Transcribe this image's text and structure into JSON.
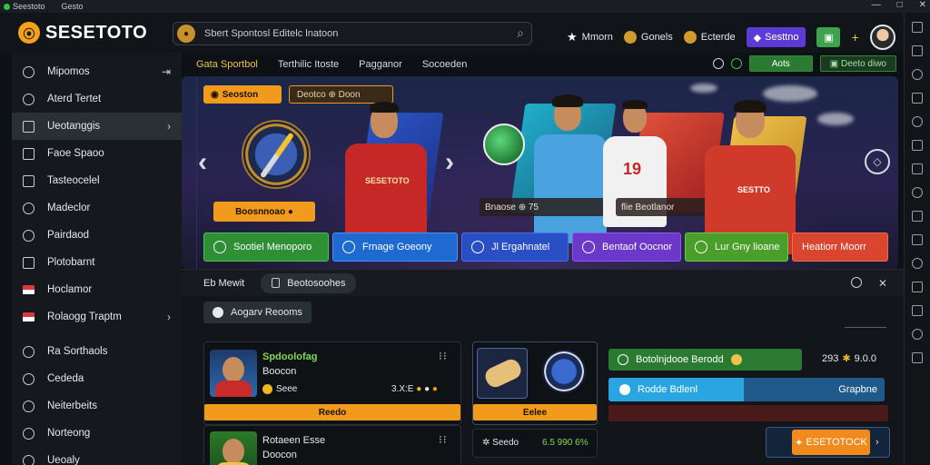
{
  "os_bar": {
    "items": [
      "Seestoto",
      "Gesto"
    ],
    "controls": [
      "—",
      "□",
      "✕"
    ]
  },
  "header": {
    "brand": "SESETOTO",
    "search_text": "Sbert Spontosl Editelc lnatoon",
    "nav": [
      {
        "icon": "star-icon",
        "label": "Mmorn"
      },
      {
        "icon": "coin-icon",
        "label": "Gonels"
      },
      {
        "icon": "coin-icon",
        "label": "Ecterde"
      }
    ],
    "purple_button": "Sesttno",
    "kebab": "⋮"
  },
  "sidebar": {
    "items": [
      {
        "label": "Mipomos",
        "arrow": "⇥",
        "active": false
      },
      {
        "label": "Aterd Tertet",
        "arrow": "",
        "active": false
      },
      {
        "label": "Ueotanggis",
        "arrow": "›",
        "active": true
      },
      {
        "label": "Faoe Spaoo",
        "arrow": "",
        "active": false
      },
      {
        "label": "Tasteocelel",
        "arrow": "",
        "active": false
      },
      {
        "label": "Madeclor",
        "arrow": "",
        "active": false
      },
      {
        "label": "Pairdaod",
        "arrow": "",
        "active": false
      },
      {
        "label": "Plotobarnt",
        "arrow": "",
        "active": false
      },
      {
        "label": "Hoclamor",
        "arrow": "",
        "active": false
      },
      {
        "label": "Rolaogg Traptm",
        "arrow": "›",
        "active": false
      },
      {
        "label": "Ra Sorthaols",
        "arrow": "",
        "active": false
      },
      {
        "label": "Cededa",
        "arrow": "",
        "active": false
      },
      {
        "label": "Neiterbeits",
        "arrow": "",
        "active": false
      },
      {
        "label": "Norteong",
        "arrow": "",
        "active": false
      },
      {
        "label": "Ueoaly",
        "arrow": "",
        "active": false
      }
    ]
  },
  "subnav": {
    "tabs": [
      {
        "label": "Gata Sportbol",
        "active": true
      },
      {
        "label": "Terthilic Itoste",
        "active": false
      },
      {
        "label": "Pagganor",
        "active": false
      },
      {
        "label": "Socoeden",
        "active": false
      }
    ],
    "pill1": "Aots",
    "pill2": "Deeto diwo"
  },
  "hero": {
    "tag_top": "Seoston",
    "tag_dark": "Deotco ⊕ Doon",
    "tag_bottom": "Boosnnoao ●",
    "player_text": "SESETOTO",
    "shirt_number": "19",
    "mid_tag": "Bnaose  ⊕ 75",
    "mid_tag2": "flie   Beotlanor",
    "right_shirt_text": "SESTTO"
  },
  "categories": [
    {
      "label": "Sootiel Menoporo",
      "color": "#2f8f35",
      "border": "#49c455"
    },
    {
      "label": "Frnage Goeony",
      "color": "#1e6ad0",
      "border": "#3f92ff"
    },
    {
      "label": "Jl Ergahnatel",
      "color": "#2a4fc4",
      "border": "#4670ea"
    },
    {
      "label": "Bentaof Oocnor",
      "color": "#6b38c9",
      "border": "#8a5af0"
    },
    {
      "label": "Lur Gny lioane",
      "color": "#4a9e2a",
      "border": "#6ccb45"
    },
    {
      "label": "Heatiorr Moorr",
      "color": "#d9452f",
      "border": "#f06a52"
    }
  ],
  "lower_bar": {
    "label": "Eb   Mewit",
    "pill": "Beotosoohes"
  },
  "approach_button": "Aogarv Reooms",
  "card1": {
    "title": "Spdoolofag",
    "sub": "Boocon",
    "badge": "Seee",
    "score": "3.X:E",
    "bar": "Reedo",
    "title2": "Rotaeen  Esse",
    "sub2": "Doocon"
  },
  "card2": {
    "bar": "Eelee",
    "footer": "Seedo",
    "score": "6.5  990  6%"
  },
  "right_panel": {
    "green_label": "Botolnjdooe Berodd",
    "score": "293",
    "score2": "9.0.0",
    "blue_label": "Rodde Bdlenl",
    "blue_right": "Grapbne",
    "blue_progress": 0.49,
    "cta": "ESETOTOCK"
  }
}
